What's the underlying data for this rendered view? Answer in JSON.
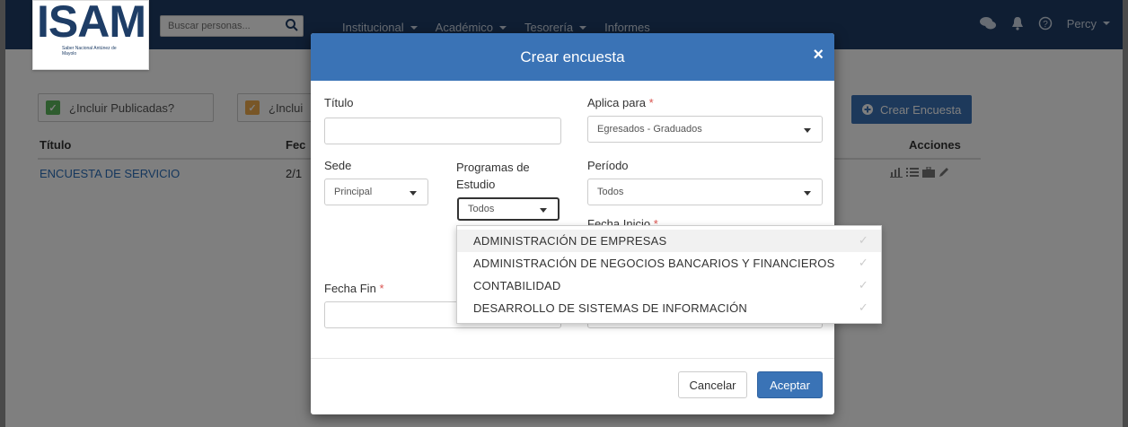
{
  "navbar": {
    "logo_text": "ISAM",
    "logo_sub": "Saber Nacional Antúnez de Mayolo",
    "search_placeholder": "Buscar personas...",
    "menu": [
      {
        "label": "Institucional"
      },
      {
        "label": "Académico"
      },
      {
        "label": "Tesorería"
      },
      {
        "label": "Informes"
      }
    ],
    "user": "Percy"
  },
  "page": {
    "filter_published": "¿Incluir Publicadas?",
    "filter_second": "¿Inclui",
    "create_button": "Crear Encuesta",
    "table": {
      "headers": {
        "title": "Título",
        "date": "Fec",
        "actions": "Acciones"
      },
      "rows": [
        {
          "title": "ENCUESTA DE SERVICIO",
          "date": "2/1"
        }
      ]
    }
  },
  "modal": {
    "title": "Crear encuesta",
    "close": "×",
    "fields": {
      "titulo_label": "Título",
      "titulo_value": "",
      "aplica_label": "Aplica para",
      "aplica_value": "Egresados - Graduados",
      "sede_label": "Sede",
      "sede_value": "Principal",
      "programas_label_1": "Programas de",
      "programas_label_2": "Estudio",
      "programas_value": "Todos",
      "periodo_label": "Período",
      "periodo_value": "Todos",
      "fecha_inicio_label": "Fecha Inicio",
      "fecha_fin_label": "Fecha Fin",
      "required_mark": "*"
    },
    "cancel": "Cancelar",
    "accept": "Aceptar"
  },
  "dropdown": {
    "options": [
      {
        "label": "ADMINISTRACIÓN DE EMPRESAS"
      },
      {
        "label": "ADMINISTRACIÓN DE NEGOCIOS BANCARIOS Y FINANCIEROS"
      },
      {
        "label": "CONTABILIDAD"
      },
      {
        "label": "DESARROLLO DE SISTEMAS DE INFORMACIÓN"
      }
    ],
    "check": "✓"
  },
  "colors": {
    "navbar": "#1e3d66",
    "primary": "#3a73b6",
    "link": "#2a6fbb",
    "required": "#d9534f",
    "check_green": "#5cb85c",
    "check_orange": "#f0ad4e"
  }
}
